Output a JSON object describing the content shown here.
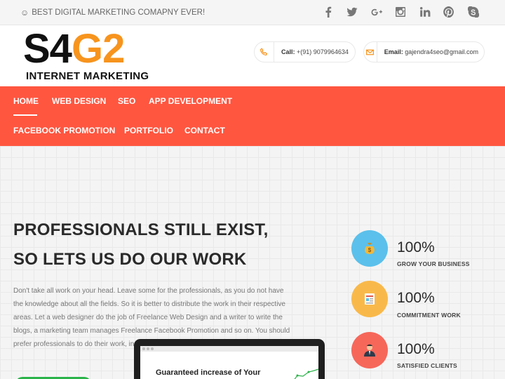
{
  "topbar": {
    "tagline": "BEST DIGITAL MARKETING COMAPNY EVER!",
    "socials": [
      "facebook-icon",
      "twitter-icon",
      "google-plus-icon",
      "instagram-icon",
      "linkedin-icon",
      "pinterest-icon",
      "skype-icon"
    ]
  },
  "logo": {
    "line1_dark": "S4",
    "line1_accent": "G2",
    "line2": "INTERNET MARKETING",
    "accent_color": "#f7941d"
  },
  "contacts": {
    "call_label": "Call:",
    "call_value": "+(91) 9079964634",
    "email_label": "Email:",
    "email_value": "gajendra4seo@gmail.com"
  },
  "nav": {
    "color": "#ff5640",
    "items": [
      "HOME",
      "WEB DESIGN",
      "SEO",
      "APP DEVELOPMENT",
      "FACEBOOK PROMOTION",
      "PORTFOLIO",
      "CONTACT"
    ],
    "active": "HOME"
  },
  "hero": {
    "headline_line1": "PROFESSIONALS STILL EXIST,",
    "headline_line2": "SO LETS US DO OUR WORK",
    "paragraph": "Don't take all work on your head. Leave some for the professionals, as you do not have the knowledge about all the fields. So it is better to distribute the work in their respective areas. Let a web designer do the job of Freelance Web Design and a writer to write the blogs, a marketing team manages Freelance Facebook Promotion and so on. You should prefer professionals to do their work, in",
    "laptop_text": "Guaranteed increase of Your"
  },
  "stats": [
    {
      "value": "100%",
      "label": "GROW YOUR BUSINESS",
      "icon": "money-bag-icon",
      "color": "#5bc0eb"
    },
    {
      "value": "100%",
      "label": "COMMITMENT WORK",
      "icon": "document-icon",
      "color": "#f9b94a"
    },
    {
      "value": "100%",
      "label": "SATISFIED CLIENTS",
      "icon": "businessman-icon",
      "color": "#f6675a"
    }
  ]
}
